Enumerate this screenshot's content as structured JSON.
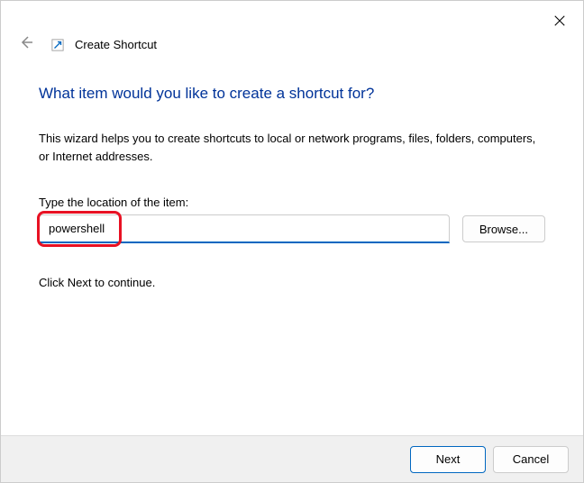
{
  "window": {
    "title": "Create Shortcut"
  },
  "heading": "What item would you like to create a shortcut for?",
  "description": "This wizard helps you to create shortcuts to local or network programs, files, folders, computers, or Internet addresses.",
  "input": {
    "label": "Type the location of the item:",
    "value": "powershell"
  },
  "buttons": {
    "browse": "Browse...",
    "next": "Next",
    "cancel": "Cancel"
  },
  "continue_text": "Click Next to continue."
}
